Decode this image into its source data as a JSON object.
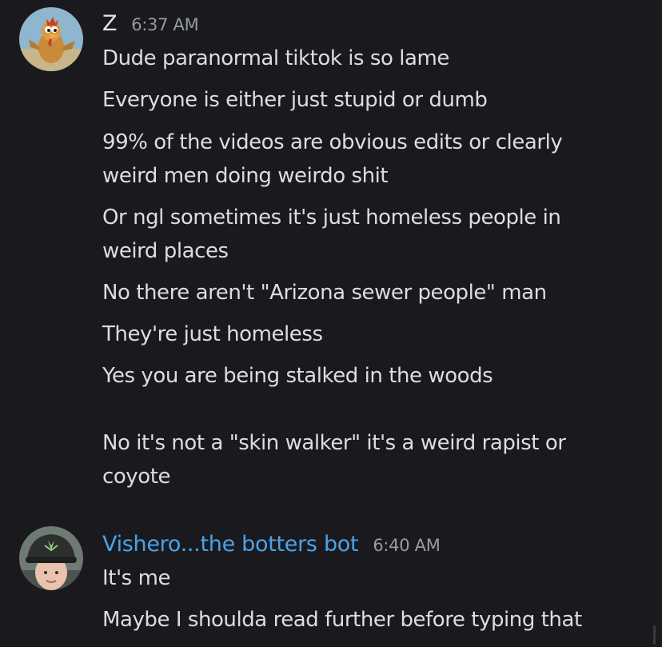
{
  "messages": [
    {
      "username": "Z",
      "username_color": "#e4e5e8",
      "timestamp": "6:37 AM",
      "avatar_icon": "rooster-cartoon-avatar",
      "lines": [
        "Dude paranormal tiktok is so lame",
        "Everyone is either just stupid or dumb",
        "99% of the videos are obvious edits or clearly",
        "weird men doing weirdo shit",
        "Or ngl sometimes it's just homeless people in",
        "weird places",
        "No there aren't \"Arizona sewer people\" man",
        "They're just homeless",
        "Yes you are being stalked in the woods",
        "No it's not a \"skin walker\" it's a weird rapist or",
        "coyote"
      ]
    },
    {
      "username": "Vishero...the botters bot",
      "username_color": "#4aa3e8",
      "timestamp": "6:40 AM",
      "avatar_icon": "person-with-cap-avatar",
      "lines": [
        "It's me",
        "Maybe I shoulda read further before typing that"
      ]
    }
  ]
}
